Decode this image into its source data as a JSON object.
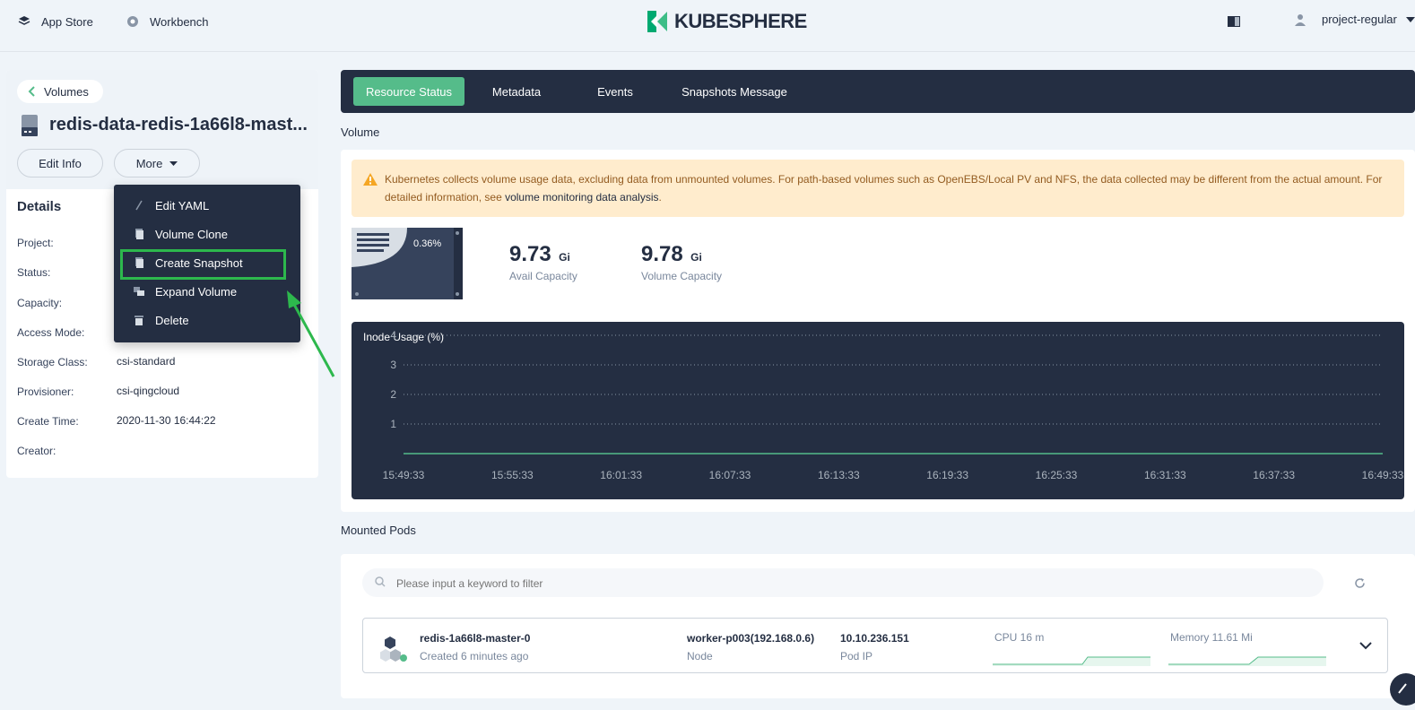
{
  "topbar": {
    "app_store": "App Store",
    "workbench": "Workbench",
    "logo": "KUBESPHERE",
    "user": "project-regular"
  },
  "left": {
    "back_label": "Volumes",
    "title": "redis-data-redis-1a66l8-mast...",
    "edit_info": "Edit Info",
    "more": "More",
    "details_title": "Details",
    "details": [
      {
        "label": "Project:",
        "value": ""
      },
      {
        "label": "Status:",
        "value": ""
      },
      {
        "label": "Capacity:",
        "value": ""
      },
      {
        "label": "Access Mode:",
        "value": ""
      },
      {
        "label": "Storage Class:",
        "value": "csi-standard"
      },
      {
        "label": "Provisioner:",
        "value": "csi-qingcloud"
      },
      {
        "label": "Create Time:",
        "value": "2020-11-30 16:44:22"
      },
      {
        "label": "Creator:",
        "value": ""
      }
    ]
  },
  "menu": {
    "items": [
      {
        "label": "Edit YAML",
        "icon": "pen-icon"
      },
      {
        "label": "Volume Clone",
        "icon": "copy-icon"
      },
      {
        "label": "Create Snapshot",
        "icon": "copy-icon"
      },
      {
        "label": "Expand Volume",
        "icon": "expand-icon"
      },
      {
        "label": "Delete",
        "icon": "trash-icon"
      }
    ]
  },
  "tabs": [
    "Resource Status",
    "Metadata",
    "Events",
    "Snapshots Message"
  ],
  "volume": {
    "section": "Volume",
    "warning_text": "Kubernetes collects volume usage data, excluding data from unmounted volumes. For path-based volumes such as OpenEBS/Local PV and NFS, the data collected may be different from the actual amount. For detailed information, see ",
    "warning_link": "volume monitoring data analysis",
    "warning_end": ".",
    "usage_percent": "0.36%",
    "avail_value": "9.73",
    "avail_unit": "Gi",
    "avail_label": "Avail Capacity",
    "cap_value": "9.78",
    "cap_unit": "Gi",
    "cap_label": "Volume Capacity"
  },
  "chart_data": {
    "type": "line",
    "title": "Inode Usage (%)",
    "x": [
      "15:49:33",
      "15:55:33",
      "16:01:33",
      "16:07:33",
      "16:13:33",
      "16:19:33",
      "16:25:33",
      "16:31:33",
      "16:37:33",
      "16:49:33"
    ],
    "y_ticks": [
      1,
      2,
      3,
      4
    ],
    "ylim": [
      0,
      4
    ],
    "series": [
      {
        "values": [
          0,
          0,
          0,
          0,
          0,
          0,
          0,
          0,
          0,
          0
        ]
      }
    ],
    "grid": true,
    "line_color": "#55bc8a"
  },
  "pods": {
    "section": "Mounted Pods",
    "search_placeholder": "Please input a keyword to filter",
    "rows": [
      {
        "name": "redis-1a66l8-master-0",
        "created": "Created 6 minutes ago",
        "node": "worker-p003(192.168.0.6)",
        "node_label": "Node",
        "ip": "10.10.236.151",
        "ip_label": "Pod IP",
        "cpu": "CPU 16 m",
        "memory": "Memory 11.61 Mi"
      }
    ]
  },
  "colors": {
    "accent": "#55bc8a",
    "dark": "#242e42",
    "highlight": "#2db84d"
  }
}
